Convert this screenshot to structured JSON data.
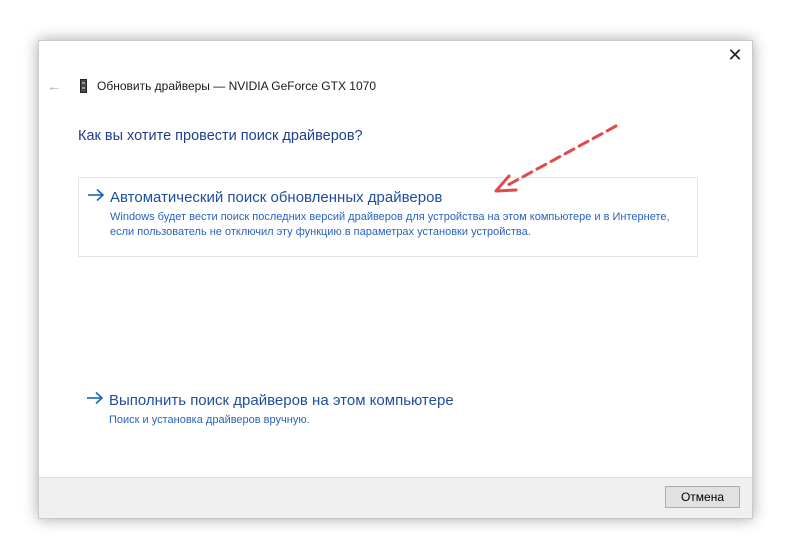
{
  "window": {
    "title": "Обновить драйверы — NVIDIA GeForce GTX 1070",
    "close_glyph": "✕",
    "back_glyph": "←"
  },
  "main": {
    "heading": "Как вы хотите провести поиск драйверов?",
    "options": [
      {
        "title": "Автоматический поиск обновленных драйверов",
        "description": "Windows будет вести поиск последних версий драйверов для устройства на этом компьютере и в Интернете, если пользователь не отключил эту функцию в параметрах установки устройства."
      },
      {
        "title": "Выполнить поиск драйверов на этом компьютере",
        "description": "Поиск и установка драйверов вручную."
      }
    ]
  },
  "footer": {
    "cancel_label": "Отмена"
  },
  "colors": {
    "heading": "#1e3f8c",
    "link": "#1f4e9c",
    "description": "#2a62c0",
    "arrow": "#1565c0",
    "annotation": "#e24a4a",
    "footer_bg": "#f0f0f0"
  },
  "icons": {
    "back": "arrow-left-icon",
    "device": "graphics-card-icon",
    "option": "arrow-right-icon",
    "close": "close-icon",
    "annotation": "dashed-red-arrow"
  }
}
